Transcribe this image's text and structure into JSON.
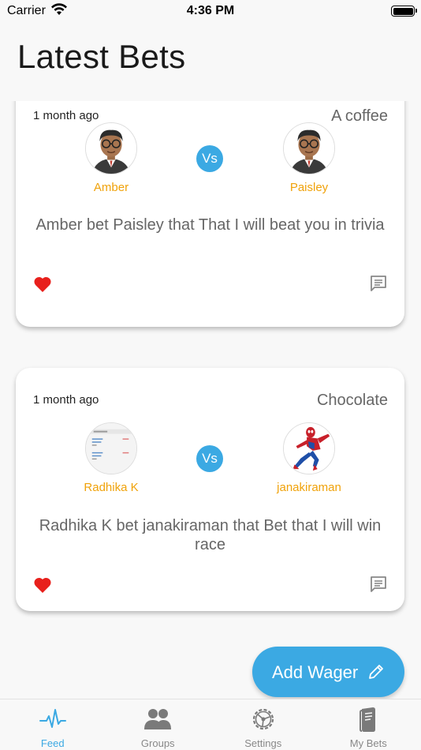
{
  "status_bar": {
    "carrier": "Carrier",
    "time": "4:36 PM"
  },
  "page_title": "Latest Bets",
  "bets": [
    {
      "time_ago": "1 month ago",
      "reward": "A coffee",
      "player1": {
        "name": "Amber",
        "avatar": "cartoon-man-avatar"
      },
      "vs_label": "Vs",
      "player2": {
        "name": "Paisley",
        "avatar": "cartoon-man-avatar"
      },
      "description": "Amber bet Paisley that That I will beat you in trivia",
      "liked": true
    },
    {
      "time_ago": "1 month ago",
      "reward": "Chocolate",
      "player1": {
        "name": "Radhika K",
        "avatar": "screenshot-avatar"
      },
      "vs_label": "Vs",
      "player2": {
        "name": "janakiraman",
        "avatar": "spiderman-avatar"
      },
      "description": "Radhika K bet janakiraman that Bet that I will win race",
      "liked": true
    }
  ],
  "fab": {
    "label": "Add Wager",
    "icon": "pencil-icon"
  },
  "tabs": [
    {
      "label": "Feed",
      "icon": "pulse-icon",
      "active": true
    },
    {
      "label": "Groups",
      "icon": "people-icon",
      "active": false
    },
    {
      "label": "Settings",
      "icon": "gear-icon",
      "active": false
    },
    {
      "label": "My Bets",
      "icon": "book-icon",
      "active": false
    }
  ],
  "colors": {
    "accent": "#3ba9e3",
    "player_name": "#f0a20a",
    "heart": "#e8201c",
    "background": "#f8f8f8"
  }
}
